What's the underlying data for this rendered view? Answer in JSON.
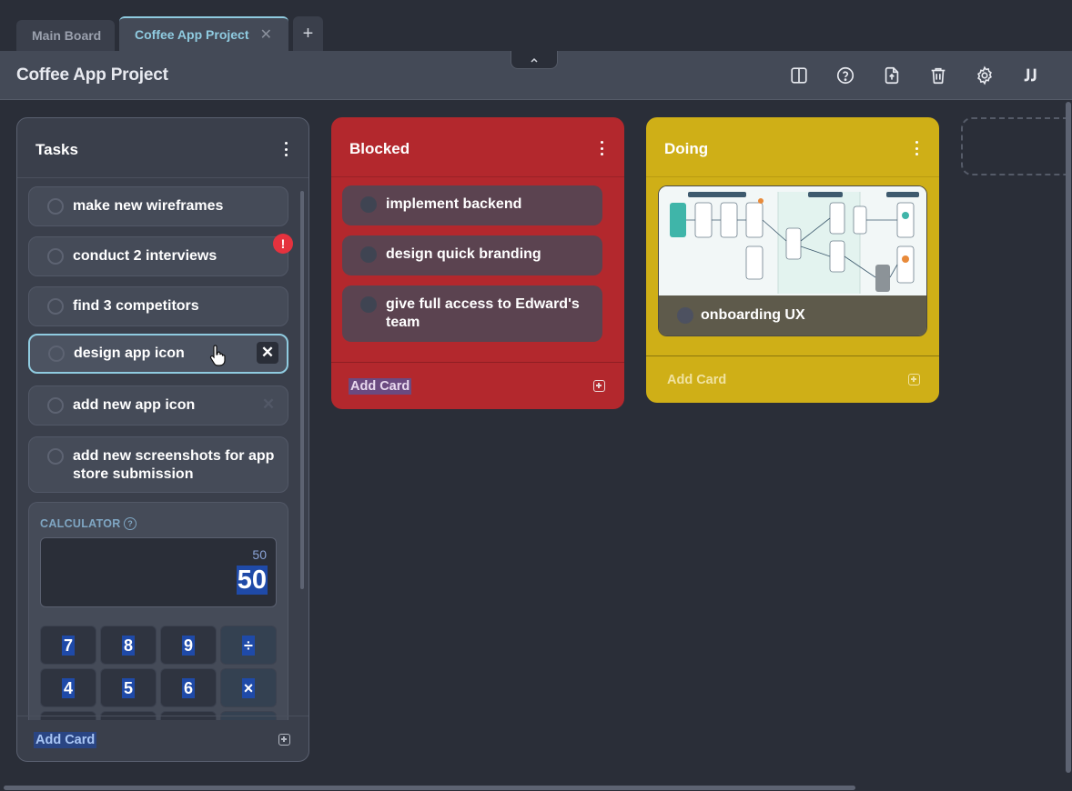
{
  "tabs": {
    "main": "Main Board",
    "active": "Coffee App Project",
    "close_glyph": "✕",
    "add_glyph": "+"
  },
  "header": {
    "title": "Coffee App Project",
    "icons": [
      "split-view-icon",
      "help-icon",
      "export-icon",
      "trash-icon",
      "settings-icon",
      "logo-icon"
    ]
  },
  "columns": {
    "tasks": {
      "title": "Tasks",
      "cards": [
        {
          "label": "make new wireframes"
        },
        {
          "label": "conduct 2 interviews",
          "alert": "!"
        },
        {
          "label": "find 3 competitors"
        },
        {
          "label": "design app icon",
          "focused": true
        },
        {
          "label": "add new app icon"
        },
        {
          "label": "add new screenshots for app store submission"
        }
      ],
      "calculator": {
        "title": "CALCULATOR",
        "help": "?",
        "previous": "50",
        "current": "50",
        "keys": [
          "7",
          "8",
          "9",
          "÷",
          "4",
          "5",
          "6",
          "×"
        ]
      },
      "add_label": "Add Card"
    },
    "blocked": {
      "title": "Blocked",
      "color": "#b3282d",
      "cards": [
        {
          "label": "implement backend"
        },
        {
          "label": "design quick branding"
        },
        {
          "label": "give full access to Edward's team"
        }
      ],
      "add_label": "Add Card"
    },
    "doing": {
      "title": "Doing",
      "color": "#cfaf17",
      "cards": [
        {
          "label": "onboarding UX"
        }
      ],
      "add_label": "Add Card"
    }
  },
  "card_close_glyph": "✕"
}
